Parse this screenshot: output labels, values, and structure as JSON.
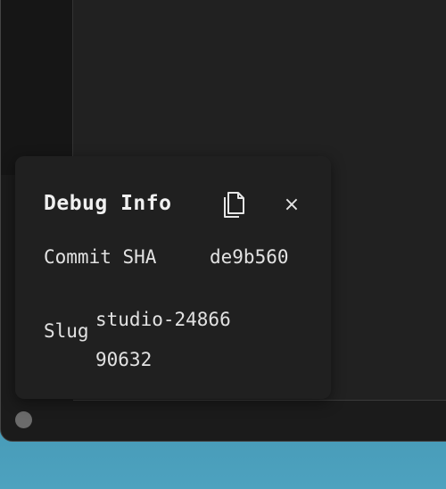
{
  "debug_panel": {
    "title": "Debug Info",
    "copy_icon": "copy-icon",
    "close_label": "×",
    "rows": [
      {
        "label": "Commit SHA",
        "value": "de9b560"
      },
      {
        "label": "Slug",
        "value": "studio-2486690632"
      }
    ]
  },
  "colors": {
    "background_gradient": "#3f8fab",
    "window": "#1b1b1b",
    "panel": "#202020",
    "text": "#e6e6e6",
    "status_dot": "#6b6b6b"
  }
}
